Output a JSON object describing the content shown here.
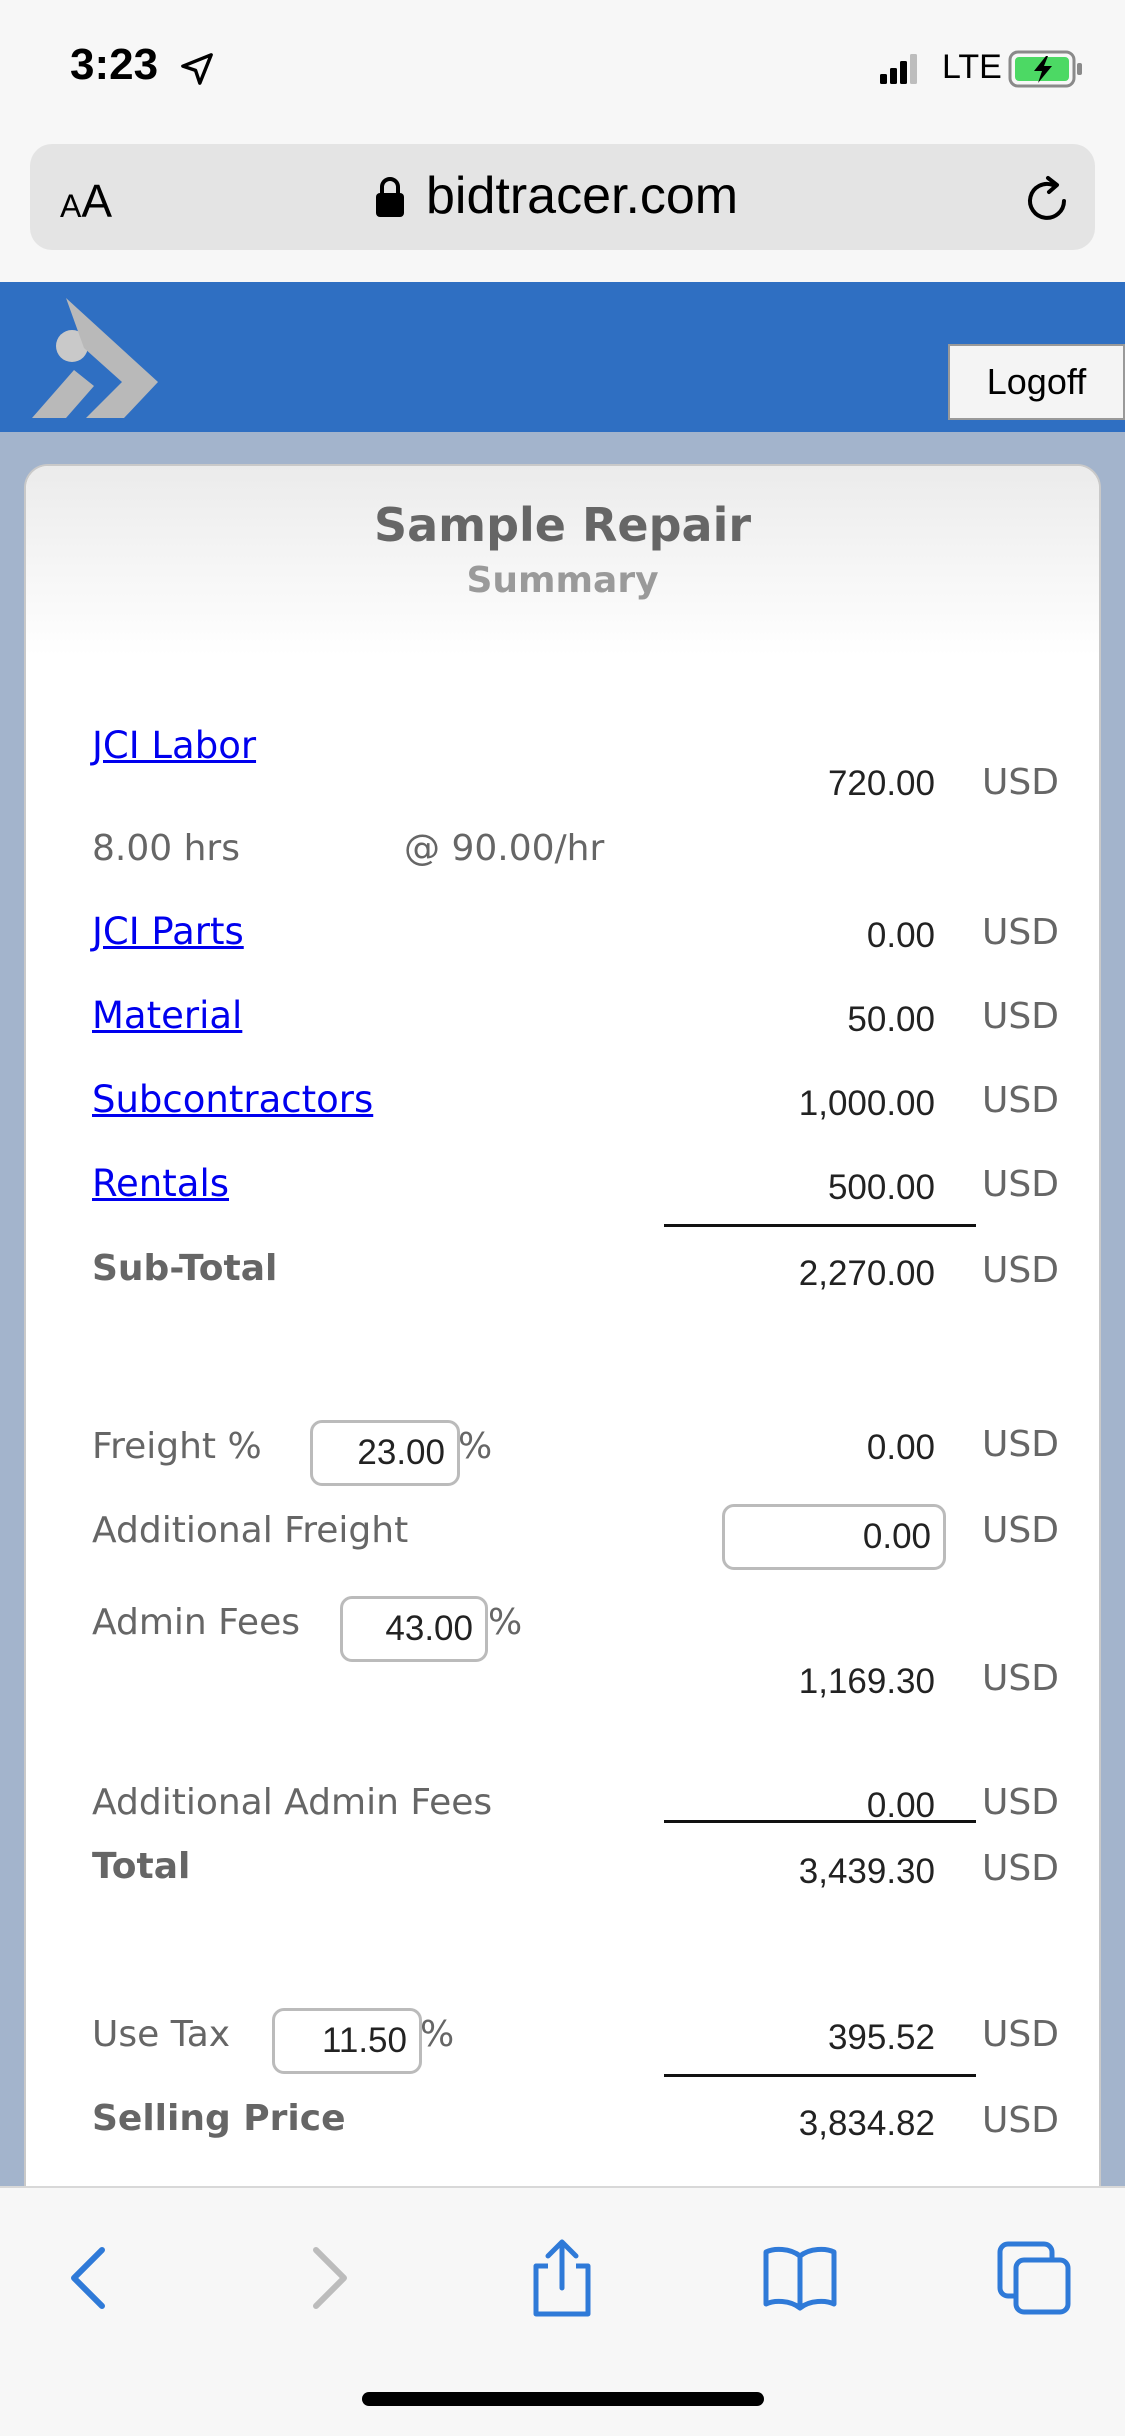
{
  "status_bar": {
    "time": "3:23",
    "network": "LTE"
  },
  "browser": {
    "aa_label_small": "A",
    "aa_label_large": "A",
    "url": "bidtracer.com"
  },
  "header": {
    "logoff_label": "Logoff"
  },
  "card": {
    "title": "Sample Repair",
    "subtitle": "Summary"
  },
  "summary": {
    "currency": "USD",
    "labor": {
      "label": "JCI Labor",
      "amount": "720.00",
      "hours": "8.00 hrs",
      "rate": "@ 90.00/hr"
    },
    "parts": {
      "label": "JCI Parts",
      "amount": "0.00"
    },
    "material": {
      "label": "Material",
      "amount": "50.00"
    },
    "subcontractors": {
      "label": "Subcontractors",
      "amount": "1,000.00"
    },
    "rentals": {
      "label": "Rentals",
      "amount": "500.00"
    },
    "subtotal": {
      "label": "Sub-Total",
      "amount": "2,270.00"
    },
    "freight": {
      "label": "Freight %",
      "percent": "23.00",
      "percent_sign": "%",
      "amount": "0.00"
    },
    "additional_freight": {
      "label": "Additional Freight",
      "value": "0.00"
    },
    "admin_fees": {
      "label": "Admin Fees",
      "percent": "43.00",
      "percent_sign": "%",
      "amount": "1,169.30"
    },
    "additional_admin_fees": {
      "label": "Additional Admin Fees",
      "amount": "0.00"
    },
    "total": {
      "label": "Total",
      "amount": "3,439.30"
    },
    "use_tax": {
      "label": "Use Tax",
      "percent": "11.50",
      "percent_sign": "%",
      "amount": "395.52"
    },
    "selling_price": {
      "label": "Selling Price",
      "amount": "3,834.82"
    }
  },
  "colors": {
    "header_blue": "#2f6fc2",
    "page_bg": "#a3b4cc",
    "ios_blue": "#2f7ad8",
    "link": "#0000ee"
  },
  "toolbar": {
    "icons": [
      "back-icon",
      "forward-icon",
      "share-icon",
      "bookmarks-icon",
      "tabs-icon"
    ]
  }
}
